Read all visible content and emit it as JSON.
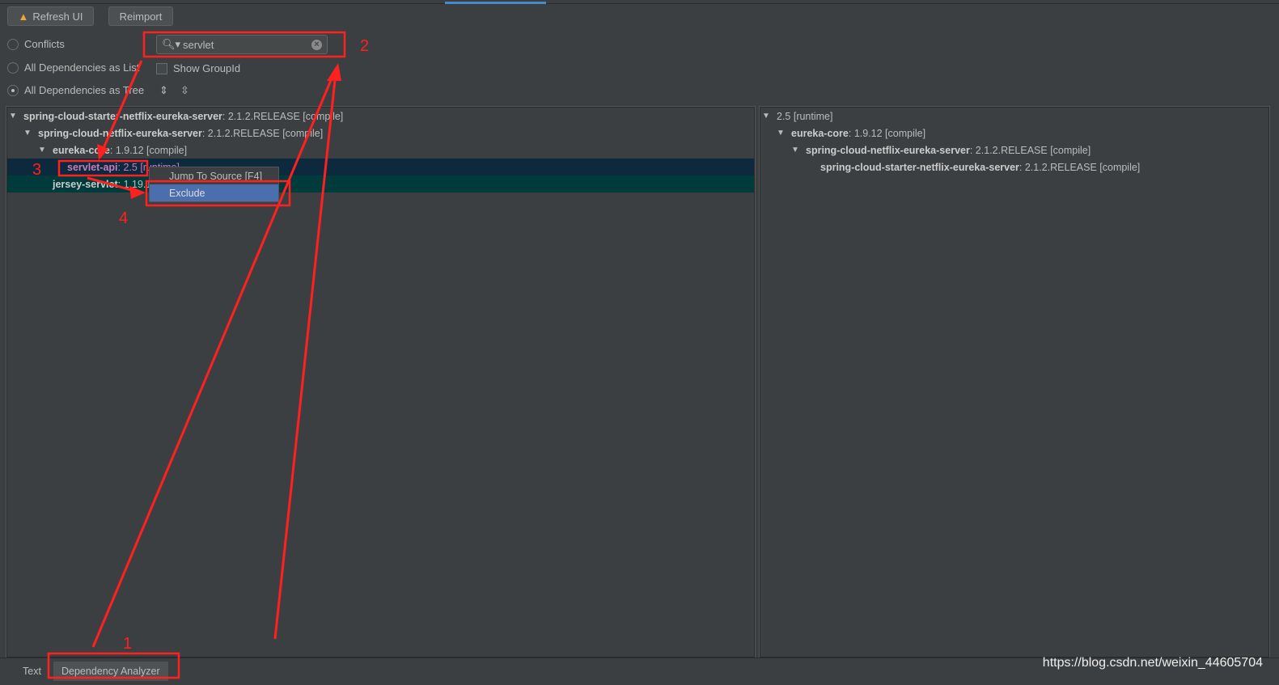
{
  "toolbar": {
    "refresh_label": "Refresh UI",
    "reimport_label": "Reimport",
    "warning_icon": "warning-icon"
  },
  "view_options": [
    {
      "label": "Conflicts",
      "selected": false
    },
    {
      "label": "All Dependencies as List",
      "selected": false
    },
    {
      "label": "All Dependencies as Tree",
      "selected": true
    }
  ],
  "search": {
    "value": "servlet"
  },
  "show_group_id": {
    "label": "Show GroupId",
    "checked": false
  },
  "left_tree": [
    {
      "name": "spring-cloud-starter-netflix-eureka-server",
      "detail": " : 2.1.2.RELEASE [compile]"
    },
    {
      "name": "spring-cloud-netflix-eureka-server",
      "detail": " : 2.1.2.RELEASE [compile]"
    },
    {
      "name": "eureka-core",
      "detail": " : 1.9.12 [compile]"
    },
    {
      "name": "servlet-api",
      "detail": " : 2.5 [runtime]"
    },
    {
      "name": "jersey-servlet",
      "detail": " : 1.19.1 [compile]"
    }
  ],
  "right_tree": [
    {
      "name": "",
      "detail": "2.5 [runtime]"
    },
    {
      "name": "eureka-core",
      "detail": " : 1.9.12 [compile]"
    },
    {
      "name": "spring-cloud-netflix-eureka-server",
      "detail": " : 2.1.2.RELEASE [compile]"
    },
    {
      "name": "spring-cloud-starter-netflix-eureka-server",
      "detail": " : 2.1.2.RELEASE [compile]"
    }
  ],
  "context_menu": {
    "items": [
      "Jump To Source [F4]",
      "Exclude"
    ]
  },
  "bottom_tabs": [
    "Text",
    "Dependency Analyzer"
  ],
  "annotations": [
    "1",
    "2",
    "3",
    "4"
  ],
  "watermark": "https://blog.csdn.net/weixin_44605704",
  "colors": {
    "accent": "#4b6eaf",
    "annotation": "#ff2020",
    "selected_row": "#0d293e",
    "match_row": "#003b3b",
    "conflict_text": "#c77dbb"
  }
}
